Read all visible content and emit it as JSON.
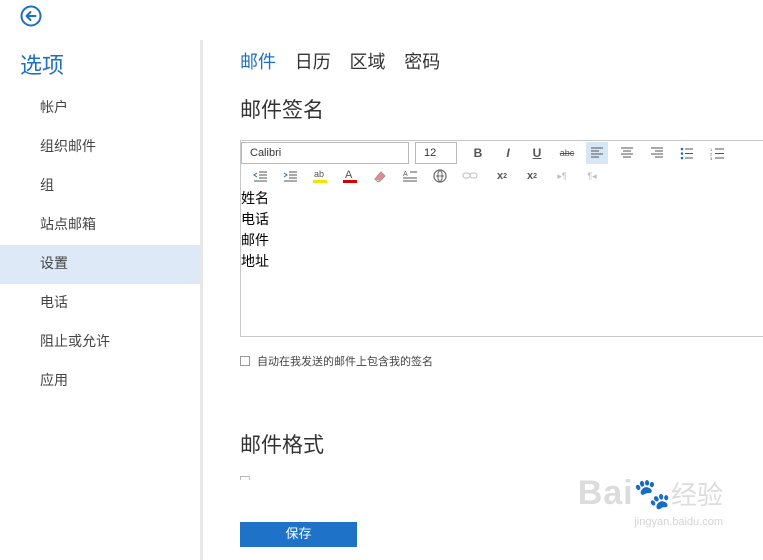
{
  "sidebar": {
    "title": "选项",
    "items": [
      {
        "label": "帐户",
        "active": false
      },
      {
        "label": "组织邮件",
        "active": false
      },
      {
        "label": "组",
        "active": false
      },
      {
        "label": "站点邮箱",
        "active": false
      },
      {
        "label": "设置",
        "active": true
      },
      {
        "label": "电话",
        "active": false
      },
      {
        "label": "阻止或允许",
        "active": false
      },
      {
        "label": "应用",
        "active": false
      }
    ]
  },
  "tabs": [
    {
      "label": "邮件",
      "active": true
    },
    {
      "label": "日历",
      "active": false
    },
    {
      "label": "区域",
      "active": false
    },
    {
      "label": "密码",
      "active": false
    }
  ],
  "signature_section": {
    "heading": "邮件签名",
    "font_name": "Calibri",
    "font_size": "12",
    "lines": [
      "姓名",
      "电话",
      "邮件",
      "地址"
    ],
    "include_checkbox_label": "自动在我发送的邮件上包含我的签名",
    "include_checked": false
  },
  "format_section": {
    "heading": "邮件格式"
  },
  "save_label": "保存",
  "watermark": {
    "main": "Bai",
    "cn": "经验",
    "sub": "jingyan.baidu.com"
  },
  "colors": {
    "accent": "#1e6fc2",
    "save_button": "#1e73c8",
    "active_nav_bg": "#dde9f6",
    "highlight_yellow": "#f2e600",
    "font_red": "#d40000"
  }
}
